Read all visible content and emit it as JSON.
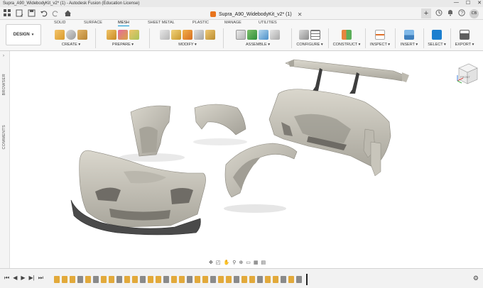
{
  "window": {
    "title": "Supra_A90_WidebodyKit_v2* (1) - Autodesk Fusion (Education License)",
    "controls": [
      "—",
      "☐",
      "✕"
    ]
  },
  "tabbar": {
    "doc_tab_label": "Supra_A90_WidebodyKit_v2* (1)",
    "close_glyph": "✕",
    "add_glyph": "+",
    "user_initials": "CB"
  },
  "ribbon": {
    "workspace_button": "DESIGN",
    "workspace_tabs": [
      "SOLID",
      "SURFACE",
      "MESH",
      "SHEET METAL",
      "PLASTIC",
      "MANAGE",
      "UTILITIES"
    ],
    "active_tab": "MESH",
    "groups": [
      "CREATE ▾",
      "PREPARE ▾",
      "MODIFY ▾",
      "ASSEMBLE ▾",
      "CONFIGURE ▾",
      "CONSTRUCT ▾",
      "INSPECT ▾",
      "INSERT ▾",
      "SELECT ▾",
      "EXPORT ▾"
    ]
  },
  "side_panel": {
    "browser_label": "BROWSER",
    "comments_label": "COMMENTS"
  },
  "viewcube": {
    "face_label": "FRONT"
  },
  "colors": {
    "accent": "#0696d7",
    "part": "#c9c6bc",
    "part_dark": "#9e9b92",
    "lip": "#4a4a4a",
    "fusion_orange": "#e8741c"
  }
}
